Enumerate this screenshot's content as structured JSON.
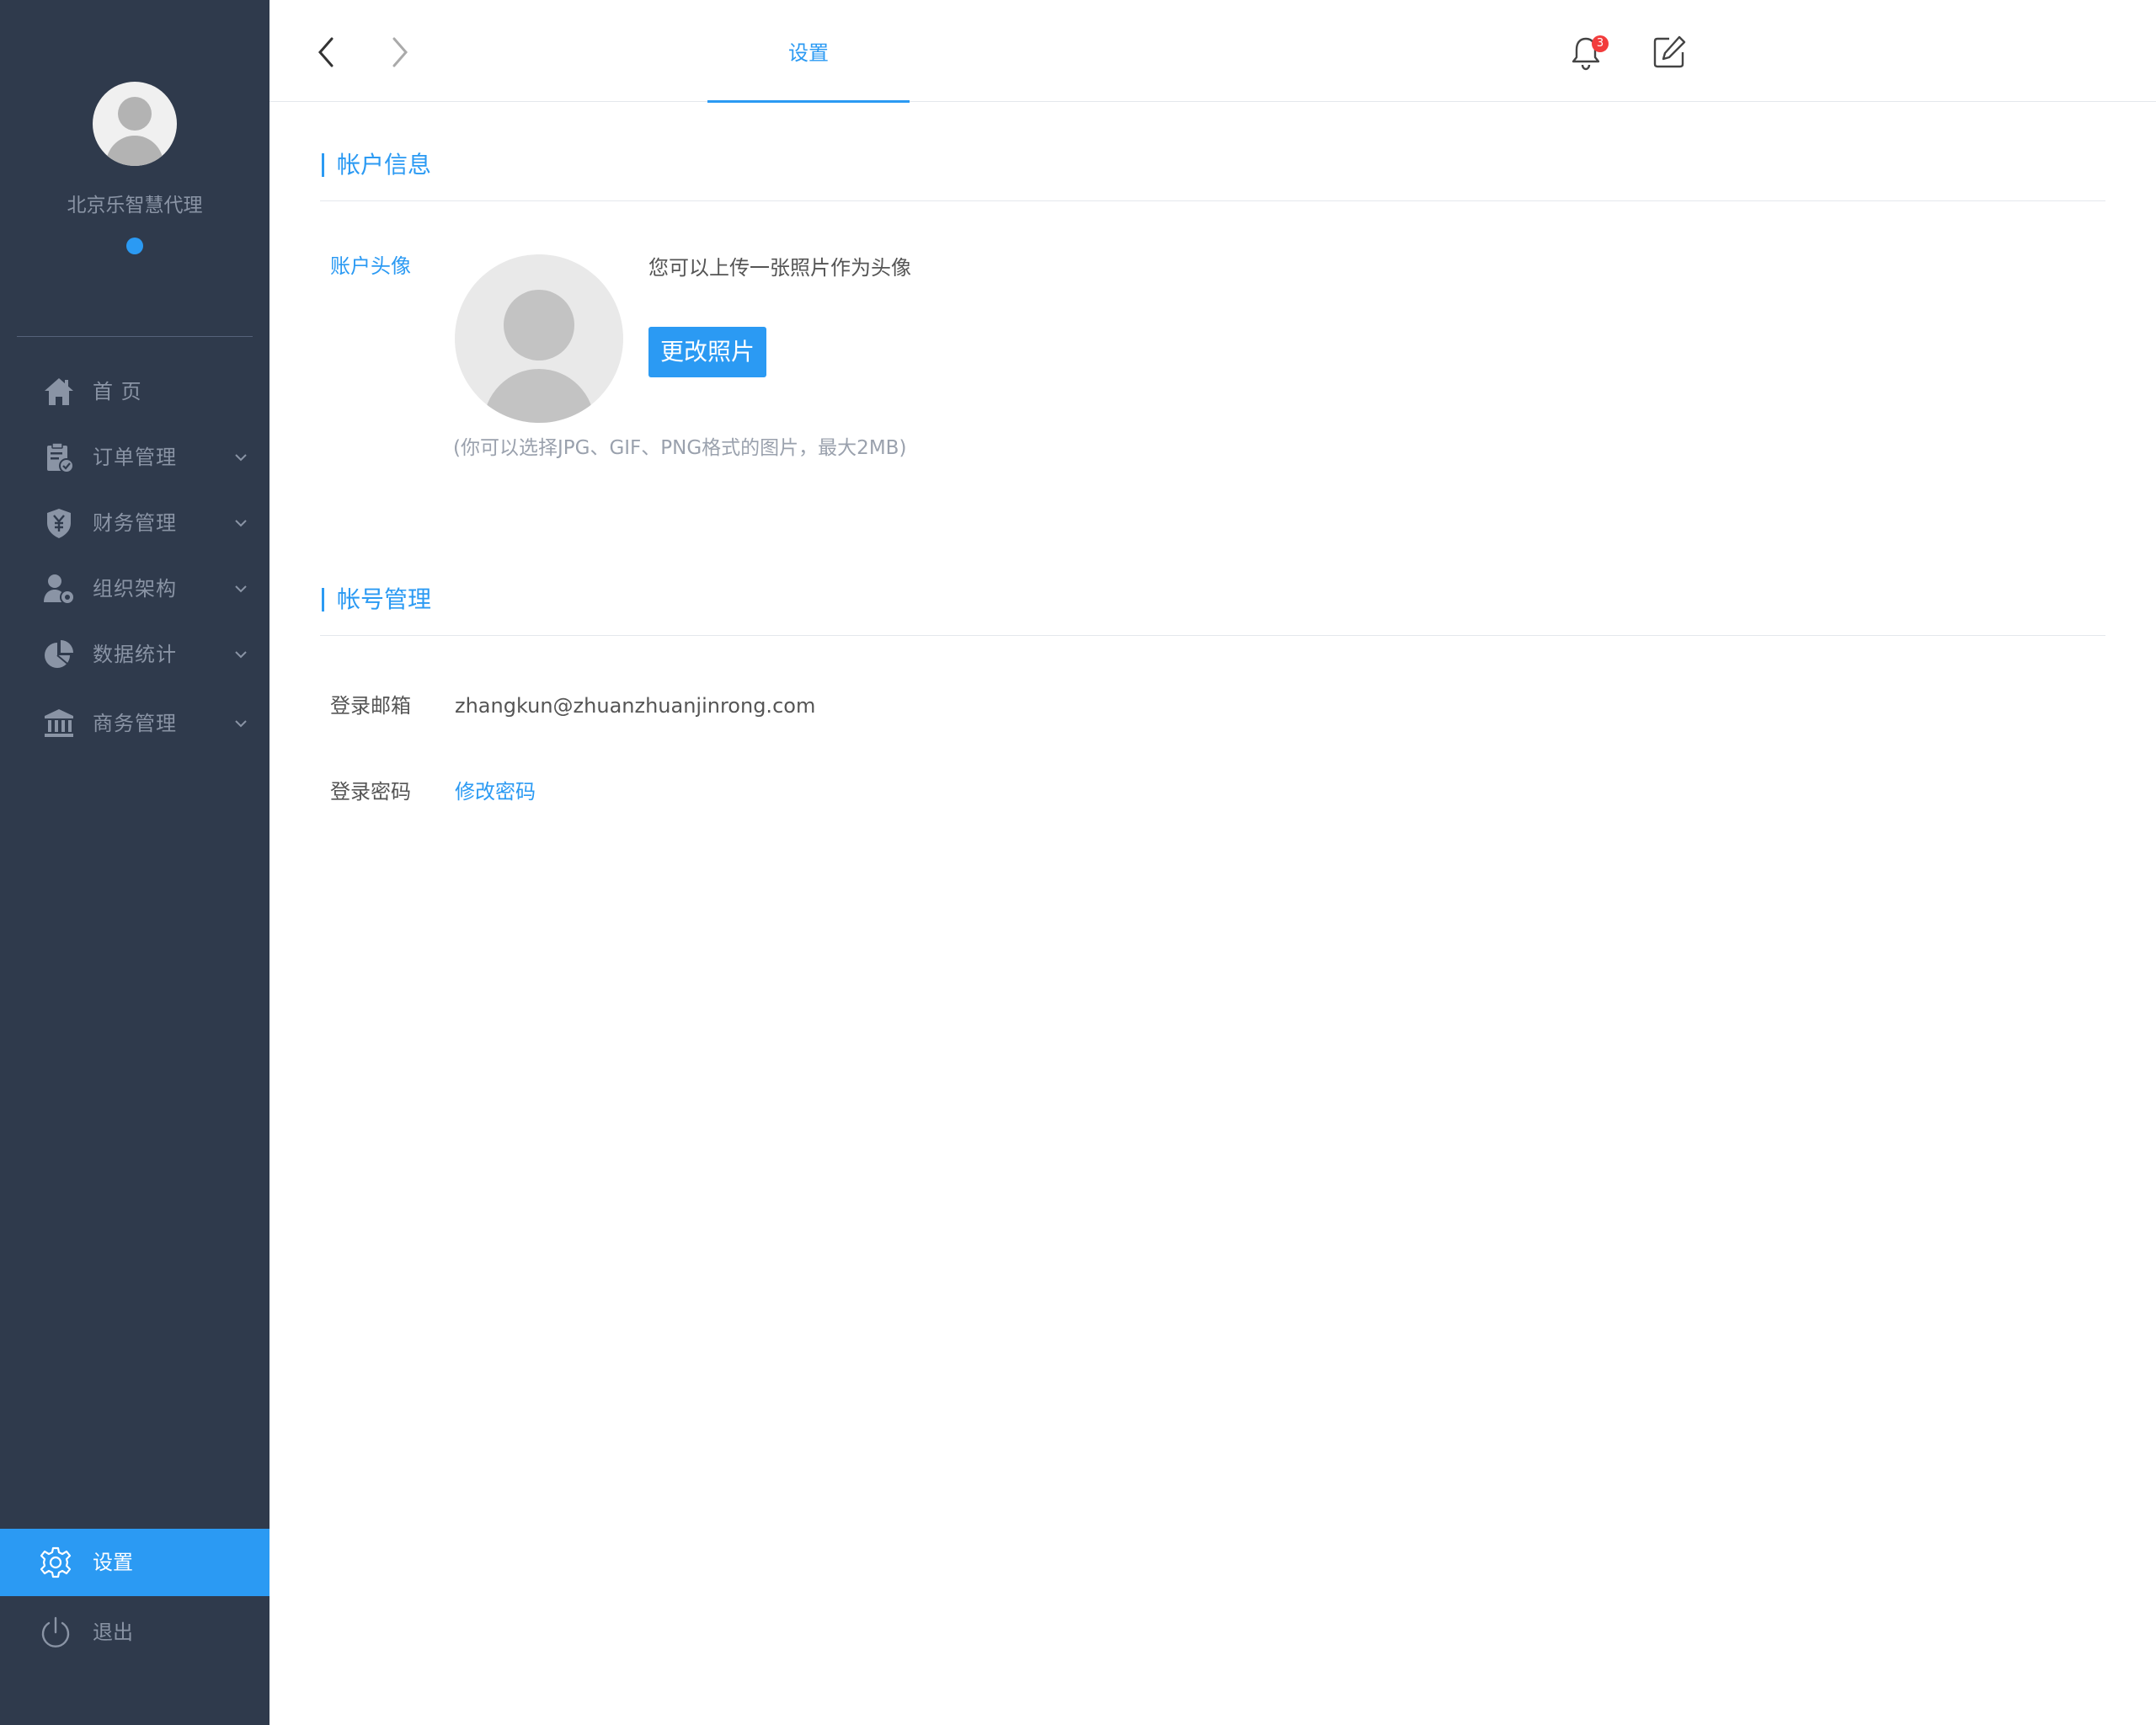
{
  "sidebar": {
    "company_name": "北京乐智慧代理",
    "status_color": "#2b9af3",
    "items": [
      {
        "label": "首 页",
        "icon": "home-icon",
        "expandable": false
      },
      {
        "label": "订单管理",
        "icon": "clipboard-check-icon",
        "expandable": true
      },
      {
        "label": "财务管理",
        "icon": "yuan-shield-icon",
        "expandable": true
      },
      {
        "label": "组织架构",
        "icon": "user-gear-icon",
        "expandable": true
      },
      {
        "label": "数据统计",
        "icon": "pie-chart-icon",
        "expandable": true
      },
      {
        "label": "商务管理",
        "icon": "bank-icon",
        "expandable": true
      }
    ],
    "bottom": [
      {
        "label": "设置",
        "icon": "gear-icon",
        "active": true
      },
      {
        "label": "退出",
        "icon": "power-icon",
        "active": false
      }
    ]
  },
  "topbar": {
    "tab_label": "设置",
    "notification_count": "3"
  },
  "account_info": {
    "title": "帐户信息",
    "avatar_label": "账户头像",
    "upload_hint": "您可以上传一张照片作为头像",
    "change_button": "更改照片",
    "format_hint": "(你可以选择JPG、GIF、PNG格式的图片，最大2MB)"
  },
  "account_manage": {
    "title": "帐号管理",
    "email_label": "登录邮箱",
    "email_value": "zhangkun@zhuanzhuanjinrong.com",
    "password_label": "登录密码",
    "password_link": "修改密码"
  },
  "colors": {
    "sidebar_bg": "#2f3a4c",
    "accent": "#2b9af3",
    "badge": "#f23c3c"
  }
}
